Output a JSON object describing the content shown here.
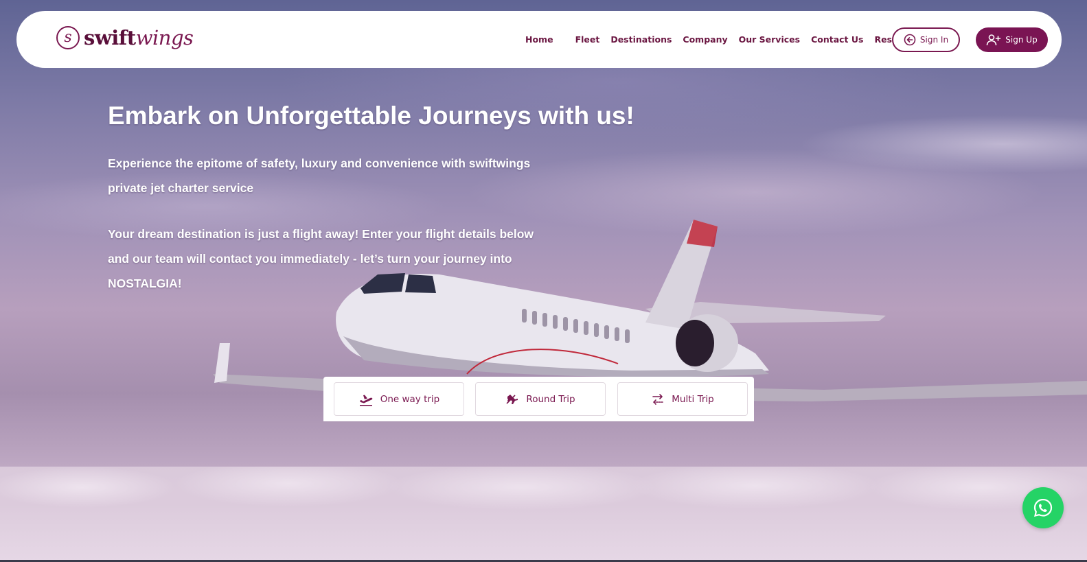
{
  "brand": {
    "logo_mark": "s",
    "name_bold": "swift",
    "name_italic": "wings",
    "primary_color": "#7a1453",
    "whatsapp_color": "#25d366"
  },
  "nav": {
    "items": [
      "Home",
      "Fleet",
      "Destinations",
      "Company",
      "Our Services",
      "Contact Us",
      "Resources"
    ]
  },
  "auth": {
    "signin_label": "Sign In",
    "signin_icon": "arrow-left-circle-icon",
    "signup_label": "Sign Up",
    "signup_icon": "user-plus-icon"
  },
  "hero": {
    "title": "Embark on Unforgettable Journeys with us!",
    "paragraph_1": "Experience the epitome of safety, luxury and convenience with swiftwings private jet charter service",
    "paragraph_2": "Your dream destination is just a flight away! Enter your flight details below and our team will contact you immediately - let’s turn your journey into NOSTALGIA!"
  },
  "trip_types": [
    {
      "label": "One way trip",
      "icon": "plane-takeoff-icon"
    },
    {
      "label": "Round Trip",
      "icon": "plane-roundtrip-icon"
    },
    {
      "label": "Multi Trip",
      "icon": "multi-arrows-icon"
    }
  ],
  "floating": {
    "whatsapp_icon": "whatsapp-icon"
  }
}
